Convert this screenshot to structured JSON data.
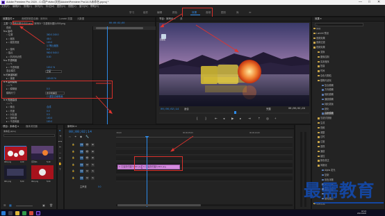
{
  "window": {
    "title": "Adobe Premiere Pro 2020 - C:\\用户\\rfzbv\\文档\\Adobe\\Premiere Pro\\14.0\\未命名.prproj *",
    "controls": [
      "—",
      "□",
      "✕"
    ]
  },
  "menu": [
    "文件(F)",
    "编辑(E)",
    "剪辑(C)",
    "序列(S)",
    "标记(M)",
    "图形(G)",
    "视图(V)",
    "窗口(W)",
    "帮助(H)"
  ],
  "workspaces": [
    "学习",
    "组件",
    "编辑",
    "颜色",
    "效果",
    "音频",
    "图形",
    "库",
    "≫"
  ],
  "workspace_active": "效果",
  "effect_controls": {
    "tabs": [
      "效果控件 ≡",
      "音频剪辑混合器：序列01",
      "Lumetri 范围",
      "元数据"
    ],
    "source_line": "主要 * 汉语音乐图片/000.png  ▸  序列01 * 汉语音乐图片/000.png",
    "timecode": "00:00:02;00",
    "rows": [
      {
        "label": "视频",
        "value": ""
      },
      {
        "label": "fx ▸ 运动",
        "value": ""
      },
      {
        "label": "○ 位置",
        "value": "360.0   240.0"
      },
      {
        "label": "▸ ○ 缩放",
        "value": "48.0"
      },
      {
        "label": "▸ ○ 缩放宽度",
        "value": "100.0"
      },
      {
        "label": "",
        "value": "☑ 等比缩放"
      },
      {
        "label": "▸ ○ 旋转",
        "value": "0.0"
      },
      {
        "label": "○ 锚点",
        "value": "960.0   540.0"
      },
      {
        "label": "▸ ○ 防闪烁滤镜",
        "value": "0.00"
      },
      {
        "label": "fx ▸ 不透明度",
        "value": ""
      },
      {
        "label": "○ □ ✎",
        "value": ""
      },
      {
        "label": "▸ ○ 不透明度",
        "value": "100.0 %"
      },
      {
        "label": "混合模式",
        "value": "正常"
      },
      {
        "label": "fx 时间重映射",
        "value": ""
      },
      {
        "label": "▸ ○ 速度",
        "value": "100.00 %"
      },
      {
        "label": "fx ▾ 高斯模糊",
        "value": ""
      },
      {
        "label": "○ □ ✎",
        "value": ""
      },
      {
        "label": "▸ ○ 模糊度",
        "value": "0.0"
      },
      {
        "label": "模糊尺寸",
        "value": "水平和垂直"
      },
      {
        "label": "",
        "value": "☐ 重复边缘像素"
      },
      {
        "label": "fx ▾ 亮度曲线",
        "value": ""
      },
      {
        "label": "○ □ ✎",
        "value": ""
      },
      {
        "label": "▸ ○ 输出",
        "value": "合成"
      },
      {
        "label": "▸ ○ 亮度",
        "value": "0.0"
      },
      {
        "label": "▸ ○ 对比度",
        "value": "0.0"
      },
      {
        "label": "▸ ○ 饱和度",
        "value": "100.0"
      },
      {
        "label": "▸ ○ 不透明度",
        "value": "100.0"
      }
    ],
    "dropdowns": [
      "正常",
      "水平和垂直"
    ]
  },
  "program": {
    "tabs": [
      "节目：序列01 ≡",
      "源"
    ],
    "timecode_left": "00;00;02;14",
    "fit_label": "适合",
    "quality_label": "完整",
    "timecode_right": "00;00;02;29",
    "desktop_icon_label": "回收站"
  },
  "project": {
    "tabs": [
      "项目：未命名 ≡",
      "媒体浏览器"
    ],
    "name": "未命名.prproj",
    "items": [
      {
        "name": "000.png",
        "dur": "3;29"
      },
      {
        "name": "序列01",
        "dur": "5;29"
      },
      {
        "name": "001.png",
        "dur": "5;00"
      },
      {
        "name": "002.png",
        "dur": "5;00"
      }
    ]
  },
  "timeline": {
    "tab": "序列01 ≡",
    "timecode": "00;00;02;14",
    "ruler": [
      ":00;00",
      "00;00;05;00",
      "00;00;10;00"
    ],
    "tracks": [
      {
        "id": "V3",
        "label": "V3"
      },
      {
        "id": "V2",
        "label": "V2"
      },
      {
        "id": "V1",
        "label": "V1"
      },
      {
        "id": "A1",
        "label": "A1"
      },
      {
        "id": "A2",
        "label": "A2"
      },
      {
        "id": "A3",
        "label": "A3"
      }
    ],
    "master": "主声道",
    "master_value": "0.0",
    "clips": [
      "fx 汉语音乐图片/000.png",
      "fx 汉语音乐图片/001.png"
    ]
  },
  "effects": {
    "tab": "效果 ≡",
    "tree": [
      {
        "depth": 0,
        "label": "预设",
        "sel": false
      },
      {
        "depth": 0,
        "label": "Lumetri 预设",
        "sel": false
      },
      {
        "depth": 0,
        "label": "音频效果",
        "sel": false
      },
      {
        "depth": 0,
        "label": "音频过渡",
        "sel": false
      },
      {
        "depth": 0,
        "label": "视频效果",
        "sel": false
      },
      {
        "depth": 1,
        "label": "变换",
        "sel": false
      },
      {
        "depth": 1,
        "label": "图像控制",
        "sel": false
      },
      {
        "depth": 1,
        "label": "实用程序",
        "sel": false
      },
      {
        "depth": 1,
        "label": "扭曲",
        "sel": false
      },
      {
        "depth": 1,
        "label": "时间",
        "sel": false
      },
      {
        "depth": 1,
        "label": "杂色与颗粒",
        "sel": false
      },
      {
        "depth": 1,
        "label": "模糊与锐化",
        "sel": false
      },
      {
        "depth": 2,
        "label": "复合模糊",
        "sel": false
      },
      {
        "depth": 2,
        "label": "方向模糊",
        "sel": false
      },
      {
        "depth": 2,
        "label": "相机模糊",
        "sel": false
      },
      {
        "depth": 2,
        "label": "通道模糊",
        "sel": false
      },
      {
        "depth": 2,
        "label": "钝化蒙版",
        "sel": false
      },
      {
        "depth": 2,
        "label": "锐化",
        "sel": false
      },
      {
        "depth": 2,
        "label": "高斯模糊",
        "sel": true
      },
      {
        "depth": 1,
        "label": "沉浸式视频",
        "sel": false
      },
      {
        "depth": 1,
        "label": "生成",
        "sel": false
      },
      {
        "depth": 1,
        "label": "视频",
        "sel": false
      },
      {
        "depth": 1,
        "label": "调整",
        "sel": false
      },
      {
        "depth": 1,
        "label": "过时",
        "sel": false
      },
      {
        "depth": 1,
        "label": "过渡",
        "sel": false
      },
      {
        "depth": 1,
        "label": "透视",
        "sel": false
      },
      {
        "depth": 1,
        "label": "通道",
        "sel": false
      },
      {
        "depth": 1,
        "label": "键控",
        "sel": false
      },
      {
        "depth": 1,
        "label": "颜色校正",
        "sel": false
      },
      {
        "depth": 1,
        "label": "风格化",
        "sel": false
      },
      {
        "depth": 2,
        "label": "Alpha 发光",
        "sel": false
      },
      {
        "depth": 2,
        "label": "复制",
        "sel": false
      },
      {
        "depth": 2,
        "label": "彩色浮雕",
        "sel": false
      },
      {
        "depth": 2,
        "label": "曝光过度",
        "sel": false
      },
      {
        "depth": 2,
        "label": "查找边缘",
        "sel": false
      },
      {
        "depth": 2,
        "label": "浮雕",
        "sel": false
      },
      {
        "depth": 2,
        "label": "画笔描边",
        "sel": false
      },
      {
        "depth": 0,
        "label": "视频过渡",
        "sel": false
      }
    ]
  },
  "taskbar": {
    "time": "18:24",
    "date": "2021/10/26"
  },
  "watermark": "最需教育",
  "colors": {
    "accent": "#2d8ceb",
    "annotation": "#e0342f",
    "clip": "#d58ce0",
    "watermark": "#1446a0"
  }
}
